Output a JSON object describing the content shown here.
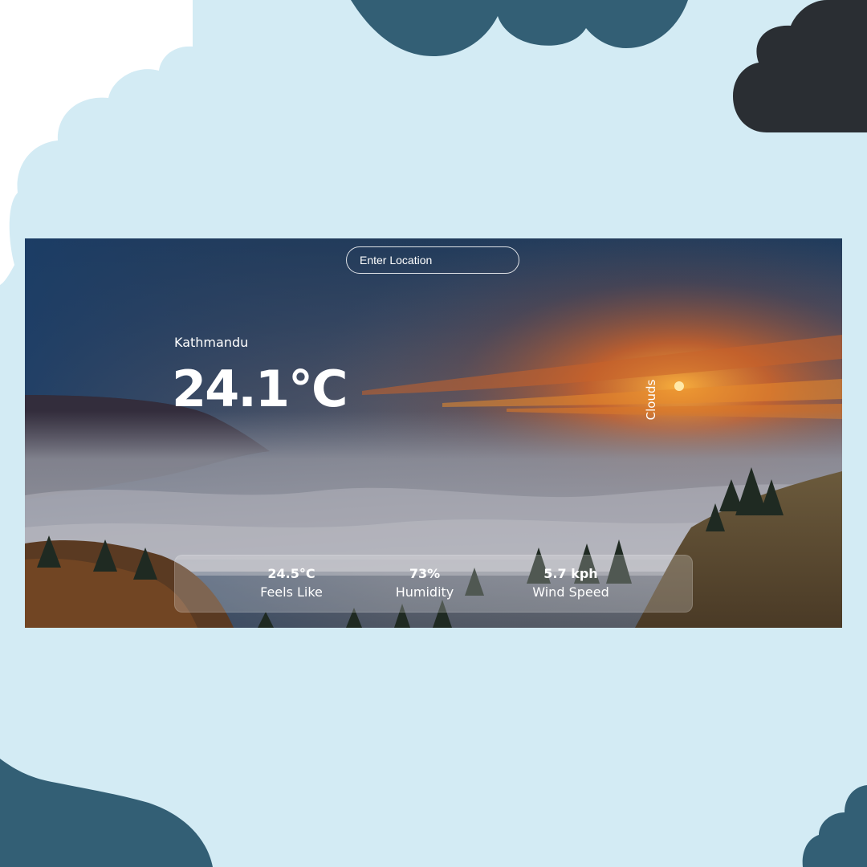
{
  "search": {
    "placeholder": "Enter Location"
  },
  "weather": {
    "location": "Kathmandu",
    "temperature": "24.1°C",
    "condition": "Clouds"
  },
  "stats": {
    "feels_like": {
      "value": "24.5°C",
      "label": "Feels Like"
    },
    "humidity": {
      "value": "73%",
      "label": "Humidity"
    },
    "wind": {
      "value": "5.7 kph",
      "label": "Wind Speed"
    }
  },
  "colors": {
    "page_background": "#d3ebf4",
    "blob_dark_blue": "#335f75",
    "blob_charcoal": "#2a2e33",
    "blob_white": "#ffffff",
    "text": "#ffffff"
  }
}
